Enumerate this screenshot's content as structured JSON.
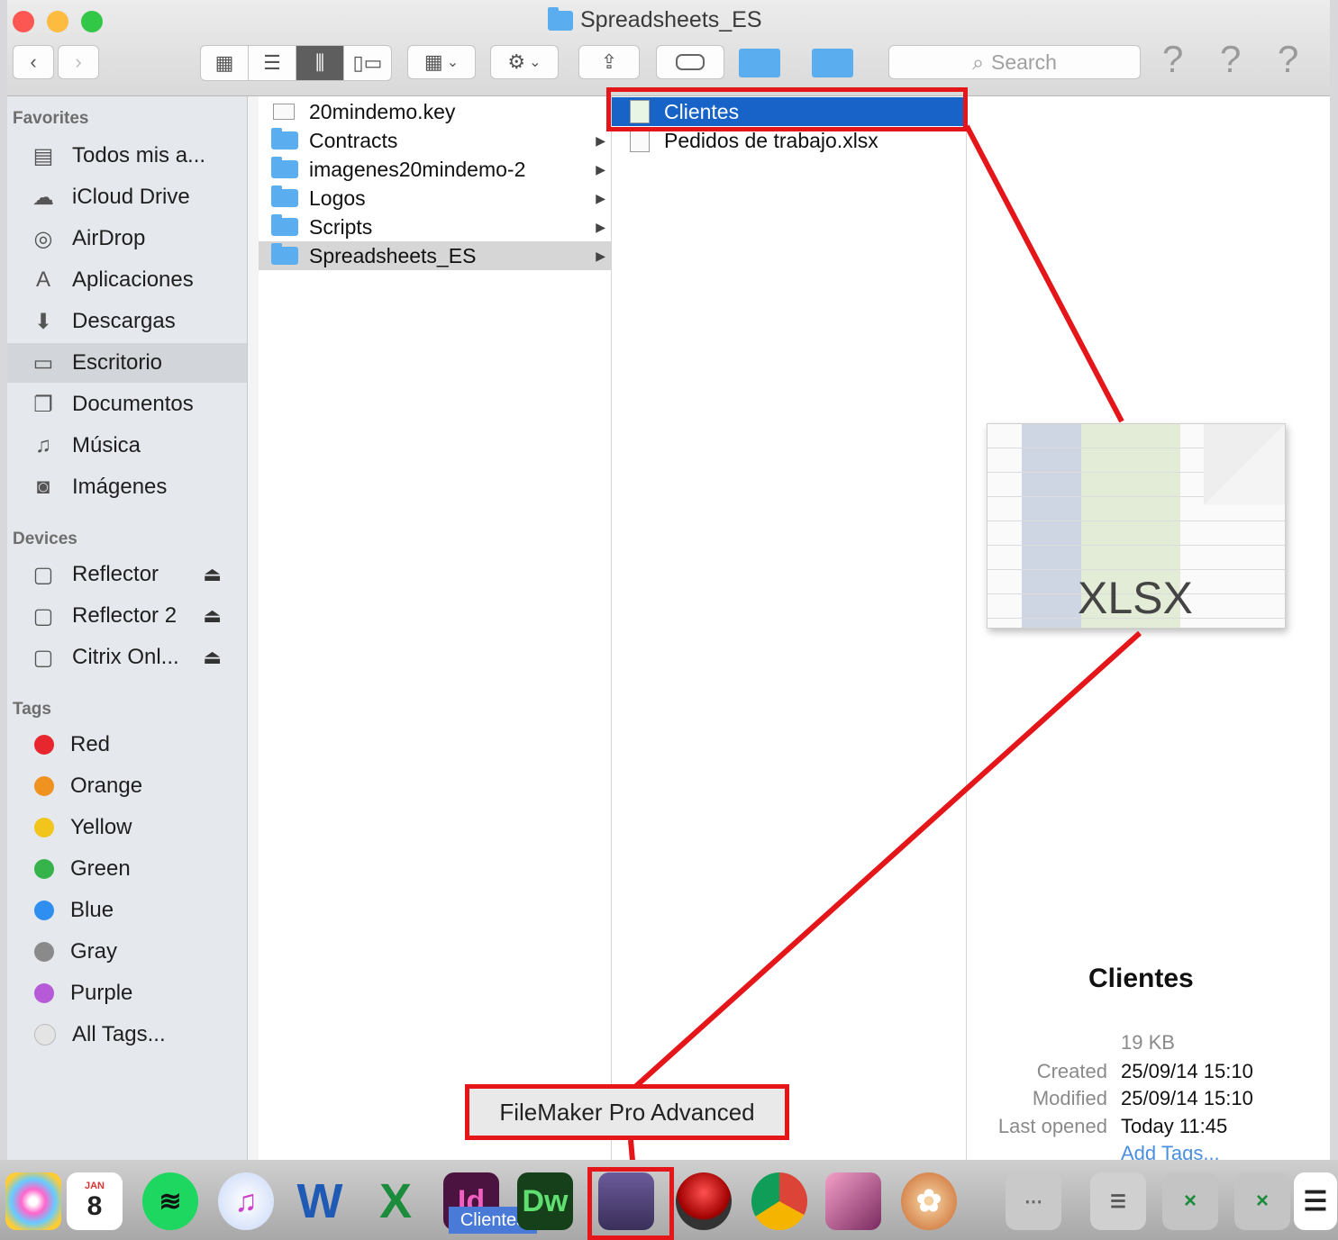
{
  "window": {
    "title": "Spreadsheets_ES"
  },
  "toolbar": {
    "back": "‹",
    "forward": "›",
    "search_placeholder": "Search",
    "help": [
      "?",
      "?",
      "?"
    ]
  },
  "sidebar": {
    "favorites_header": "Favorites",
    "favorites": [
      {
        "label": "Todos mis a...",
        "icon": "files-icon"
      },
      {
        "label": "iCloud Drive",
        "icon": "cloud-icon"
      },
      {
        "label": "AirDrop",
        "icon": "airdrop-icon"
      },
      {
        "label": "Aplicaciones",
        "icon": "apps-icon"
      },
      {
        "label": "Descargas",
        "icon": "download-icon"
      },
      {
        "label": "Escritorio",
        "icon": "desktop-icon"
      },
      {
        "label": "Documentos",
        "icon": "documents-icon"
      },
      {
        "label": "Música",
        "icon": "music-icon"
      },
      {
        "label": "Imágenes",
        "icon": "camera-icon"
      }
    ],
    "devices_header": "Devices",
    "devices": [
      {
        "label": "Reflector"
      },
      {
        "label": "Reflector 2"
      },
      {
        "label": "Citrix Onl..."
      }
    ],
    "tags_header": "Tags",
    "tags": [
      {
        "label": "Red",
        "color": "#e8262e"
      },
      {
        "label": "Orange",
        "color": "#f0921f"
      },
      {
        "label": "Yellow",
        "color": "#f1c51c"
      },
      {
        "label": "Green",
        "color": "#36b34a"
      },
      {
        "label": "Blue",
        "color": "#2f8ff0"
      },
      {
        "label": "Gray",
        "color": "#8a8a8a"
      },
      {
        "label": "Purple",
        "color": "#b65ad8"
      },
      {
        "label": "All Tags...",
        "color": "#e4e4e4"
      }
    ]
  },
  "column1": [
    {
      "label": "20mindemo.key",
      "type": "file"
    },
    {
      "label": "Contracts",
      "type": "folder"
    },
    {
      "label": "imagenes20mindemo-2",
      "type": "folder"
    },
    {
      "label": "Logos",
      "type": "folder"
    },
    {
      "label": "Scripts",
      "type": "folder"
    },
    {
      "label": "Spreadsheets_ES",
      "type": "folder"
    }
  ],
  "column2": [
    {
      "label": "Clientes"
    },
    {
      "label": "Pedidos de trabajo.xlsx"
    }
  ],
  "preview": {
    "badge": "XLSX",
    "name": "Clientes",
    "size": "19 KB",
    "created_label": "Created",
    "created": "25/09/14 15:10",
    "modified_label": "Modified",
    "modified": "25/09/14 15:10",
    "opened_label": "Last opened",
    "opened": "Today 11:45",
    "add_tags": "Add Tags..."
  },
  "dock": {
    "tooltip": "FileMaker Pro Advanced",
    "clientes_label": "Clientes",
    "calendar_day": "8",
    "calendar_month": "JAN"
  }
}
